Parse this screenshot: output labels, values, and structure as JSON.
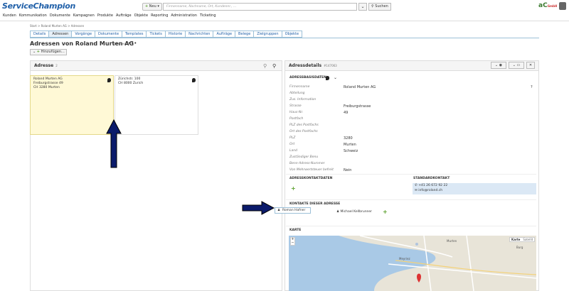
{
  "app": {
    "logo": "ServiceChampion",
    "brand": "aC",
    "brand_small": "GmbH"
  },
  "toolbar": {
    "new_label": "Neu",
    "search_placeholder": "Firmenname, Nachname, Ort, Kundennr., ...",
    "search_button": "Suchen"
  },
  "menu": [
    "Kunden",
    "Kommunikation",
    "Dokumente",
    "Kampagnen",
    "Produkte",
    "Aufträge",
    "Objekte",
    "Reporting",
    "Administration",
    "Ticketing"
  ],
  "breadcrumb": "Start > Roland Murten AG > Adressen",
  "tabs": [
    "Details",
    "Adressen",
    "Vorgänge",
    "Dokumente",
    "Templates",
    "Tickets",
    "Historie",
    "Nachrichten",
    "Aufträge",
    "Belege",
    "Zielgruppen",
    "Objekte"
  ],
  "active_tab": 1,
  "page": {
    "title": "Adressen von Roland Murten AG",
    "sub": "#194294",
    "more": "•••",
    "add_label": "Hinzufügen..."
  },
  "addresses_panel": {
    "title": "Adresse",
    "count": "2",
    "cards": [
      {
        "lines": [
          "Roland Murten AG",
          "Freiburgstrasse 49",
          "CH 3280 Murten"
        ]
      },
      {
        "lines": [
          "Zürichstr. 100",
          "CH 8000 Zurich"
        ]
      }
    ]
  },
  "details_panel": {
    "title": "Adressdetails",
    "sub": "#147063",
    "section_base": "ADRESSBASISDATEN",
    "fields": [
      {
        "label": "Firmenname",
        "value": "Roland Murten AG",
        "extra": "?"
      },
      {
        "label": "Abteilung",
        "value": ""
      },
      {
        "label": "Zus. Information",
        "value": ""
      },
      {
        "label": "Strasse",
        "value": "Freiburgstrasse"
      },
      {
        "label": "Haus-Nr.",
        "value": "49"
      },
      {
        "label": "Postfach",
        "value": ""
      },
      {
        "label": "PLZ des Postfachs",
        "value": ""
      },
      {
        "label": "Ort des Postfachs",
        "value": ""
      },
      {
        "label": "PLZ",
        "value": "3280"
      },
      {
        "label": "Ort",
        "value": "Murten"
      },
      {
        "label": "Land",
        "value": "Schweiz"
      },
      {
        "label": "Zuständiger Benu",
        "value": ""
      },
      {
        "label": "Benn-Adress-Nummer",
        "value": ""
      },
      {
        "label": "Von Mehrwertsteuer befreit",
        "value": "Nein"
      }
    ],
    "section_contactdata": "ADRESSKONTAKTDATEN",
    "section_standard": "STANDARDKONTAKT",
    "phone": "+41 26 672 92 22",
    "email": "info@roland.ch",
    "section_contacts": "KONTAKTE DIESER ADRESSE",
    "contacts": [
      "Roman Hafner",
      "Michael Kellbrunner"
    ],
    "section_map": "KARTE",
    "map_buttons": [
      "Karte",
      "Satellit"
    ],
    "map_labels": [
      "Murten",
      "Meyriez",
      "Burg"
    ]
  }
}
